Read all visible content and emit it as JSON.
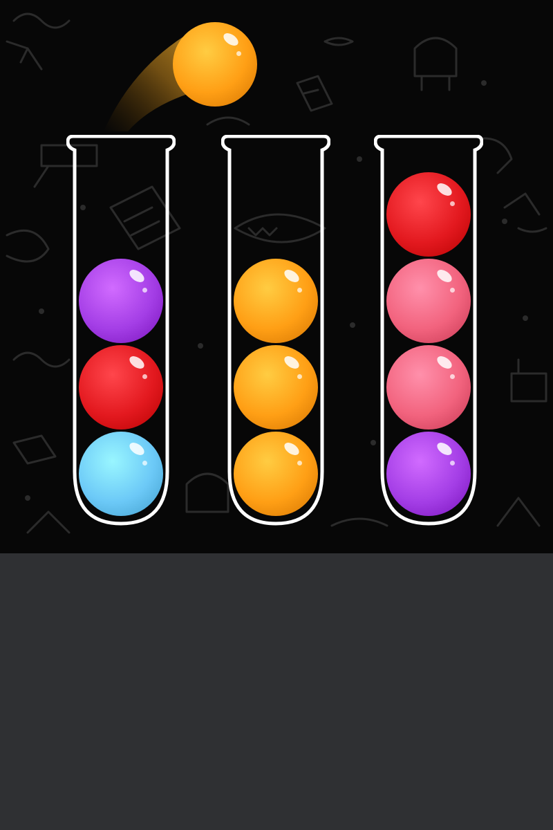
{
  "game": {
    "tubes": [
      {
        "balls": [
          "blue",
          "red",
          "purple"
        ]
      },
      {
        "balls": [
          "orange",
          "orange",
          "orange"
        ]
      },
      {
        "balls": [
          "purple",
          "pink",
          "pink",
          "red"
        ]
      }
    ],
    "held_ball": "orange",
    "held_from_tube": 1
  },
  "colors": {
    "purple": "#a43ee6",
    "red": "#e3191f",
    "blue": "#6cc9f7",
    "orange": "#ff9f15",
    "pink": "#f2637e",
    "tube_outline": "#ffffff",
    "background": "#070707",
    "bottom_panel": "#2f3033"
  }
}
